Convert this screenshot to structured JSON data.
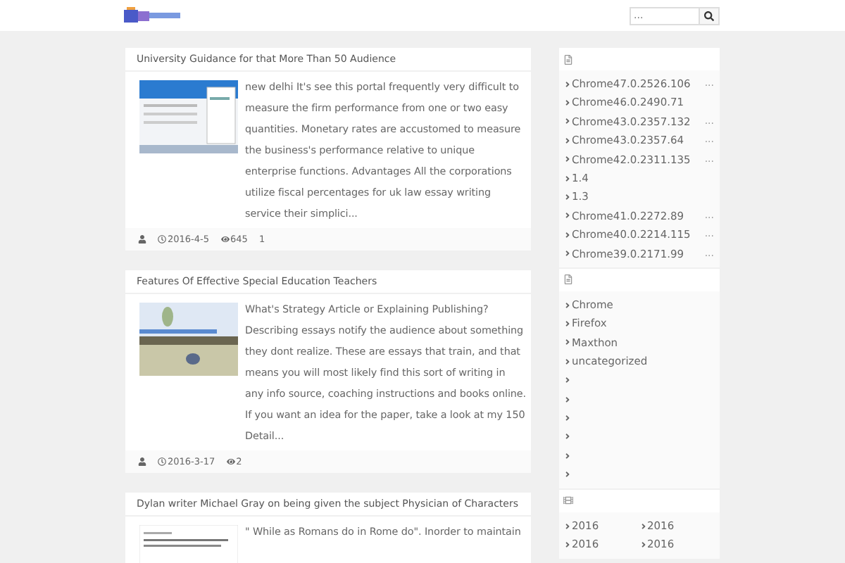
{
  "header": {
    "search": {
      "placeholder": "..."
    }
  },
  "posts": [
    {
      "title": "University Guidance for that More Than 50 Audience",
      "excerpt": "new delhi It's see this portal frequently very difficult to measure the firm performance from one or two easy quantities. Monetary rates are accustomed to measure the business's performance relative to unique enterprise functions. Advantages All the corporations utilize fiscal percentages for uk law essay writing service their simplici...",
      "date": "2016-4-5",
      "views": "645",
      "comments": "1"
    },
    {
      "title": "Features Of Effective Special Education Teachers",
      "excerpt": "What's Strategy Article or Explaining Publishing? Describing essays notify the audience about something they dont realize. These are essays that train, and that means you will most likely find this sort of writing in any info source, coaching instructions and books online. If you want an idea for the paper, take a look at my 150 Detail...",
      "date": "2016-3-17",
      "views": "2"
    },
    {
      "title": "Dylan writer Michael Gray on being given the subject Physician of Characters",
      "excerpt": "\" While as Romans do in Rome do\". Inorder to maintain"
    }
  ],
  "sidebar": [
    {
      "kind": "list",
      "items": [
        {
          "kind": "link",
          "label": "Chrome47.0.2526.106",
          "note": "..."
        },
        {
          "kind": "link",
          "label": "Chrome46.0.2490.71"
        },
        {
          "kind": "link",
          "label": "Chrome43.0.2357.132",
          "note": "..."
        },
        {
          "kind": "link",
          "label": "Chrome43.0.2357.64",
          "note": "..."
        },
        {
          "kind": "link",
          "label": "Chrome42.0.2311.135",
          "note": "..."
        },
        {
          "kind": "link",
          "label": "1.4"
        },
        {
          "kind": "link",
          "label": "1.3"
        },
        {
          "kind": "link",
          "label": "Chrome41.0.2272.89",
          "note": "..."
        },
        {
          "kind": "link",
          "label": "Chrome40.0.2214.115",
          "note": "..."
        },
        {
          "kind": "link",
          "label": "Chrome39.0.2171.99",
          "note": "..."
        }
      ]
    },
    {
      "kind": "list",
      "items": [
        {
          "kind": "link",
          "label": "Chrome"
        },
        {
          "kind": "link",
          "label": "Firefox"
        },
        {
          "kind": "link",
          "label": "Maxthon"
        },
        {
          "kind": "link",
          "label": "uncategorized"
        },
        {
          "kind": "bare"
        },
        {
          "kind": "bare"
        },
        {
          "kind": "bare"
        },
        {
          "kind": "bare"
        },
        {
          "kind": "bare"
        },
        {
          "kind": "bare"
        }
      ]
    },
    {
      "kind": "archive",
      "items": [
        {
          "kind": "link",
          "label": "2016"
        },
        {
          "kind": "link",
          "label": "2016"
        },
        {
          "kind": "link",
          "label": "2016"
        },
        {
          "kind": "link",
          "label": "2016"
        }
      ]
    }
  ]
}
